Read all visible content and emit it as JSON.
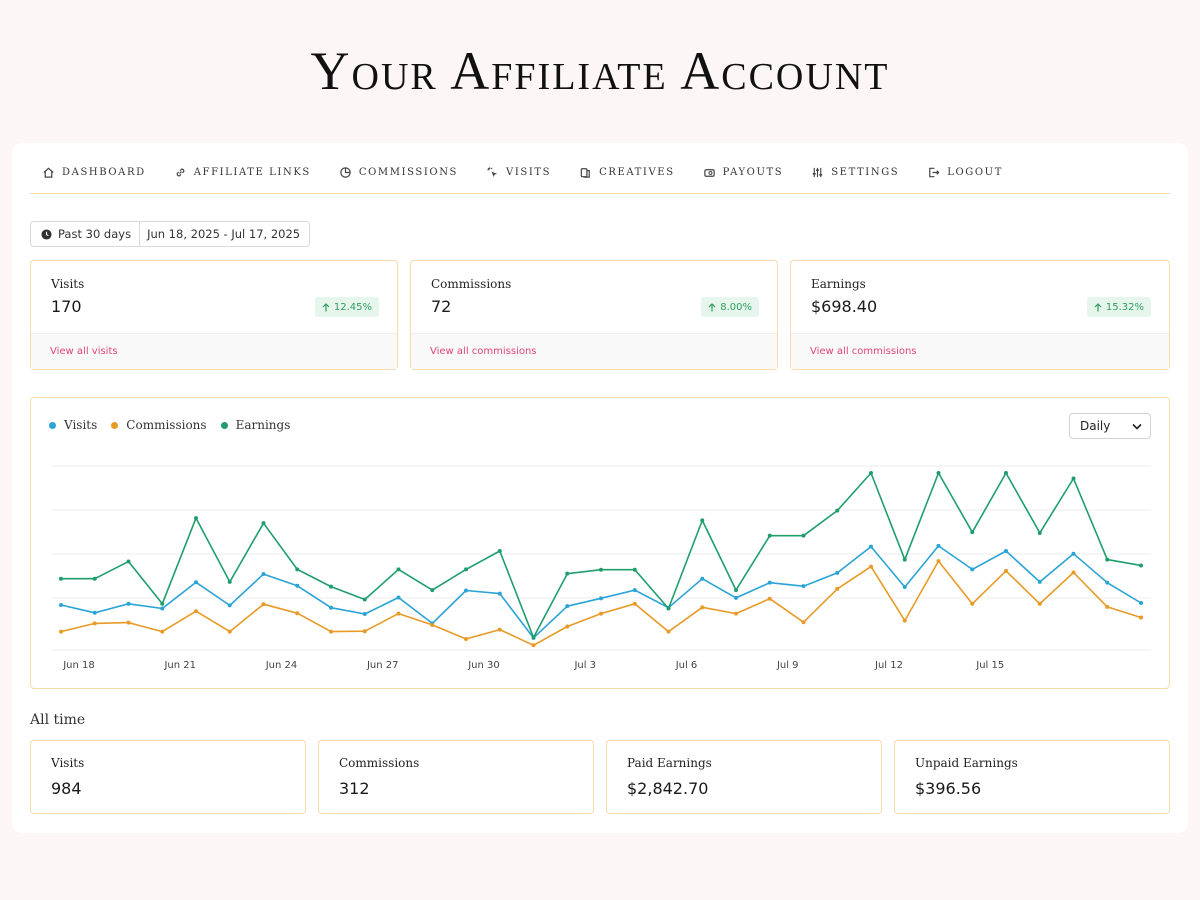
{
  "heading": "Your Affiliate Account",
  "nav": [
    {
      "label": "DASHBOARD",
      "icon": "home-icon"
    },
    {
      "label": "AFFILIATE LINKS",
      "icon": "link-icon"
    },
    {
      "label": "COMMISSIONS",
      "icon": "pie-chart-icon"
    },
    {
      "label": "VISITS",
      "icon": "cursor-click-icon"
    },
    {
      "label": "CREATIVES",
      "icon": "images-icon"
    },
    {
      "label": "PAYOUTS",
      "icon": "wallet-icon"
    },
    {
      "label": "SETTINGS",
      "icon": "sliders-icon"
    },
    {
      "label": "LOGOUT",
      "icon": "logout-icon"
    }
  ],
  "date_range": {
    "preset": "Past 30 days",
    "dates": "Jun 18, 2025 - Jul 17, 2025"
  },
  "cards": [
    {
      "label": "Visits",
      "value": "170",
      "change": "12.45%",
      "link": "View all visits"
    },
    {
      "label": "Commissions",
      "value": "72",
      "change": "8.00%",
      "link": "View all commissions"
    },
    {
      "label": "Earnings",
      "value": "$698.40",
      "change": "15.32%",
      "link": "View all commissions"
    }
  ],
  "chart_controls": {
    "interval": "Daily"
  },
  "chart_data": {
    "type": "line",
    "x_tick_labels": [
      "Jun 18",
      "Jun 21",
      "Jun 24",
      "Jun 27",
      "Jun 30",
      "Jul 3",
      "Jul 6",
      "Jul 9",
      "Jul 12",
      "Jul 15"
    ],
    "grid": true,
    "legend_position": "top-left",
    "series": [
      {
        "name": "Visits",
        "color": "#2aa3d6",
        "values": [
          9.5,
          7.5,
          9.8,
          8.6,
          15.3,
          9.4,
          17.4,
          14.4,
          8.8,
          7.2,
          11.4,
          4.8,
          13.2,
          12.4,
          1.1,
          9.2,
          11.2,
          13.3,
          8.8,
          16.2,
          11.3,
          15.2,
          14.3,
          17.7,
          24.4,
          14.1,
          24.6,
          18.6,
          23.3,
          15.4,
          22.6,
          15.2,
          10.0
        ]
      },
      {
        "name": "Commissions",
        "color": "#e89a26",
        "values": [
          2.7,
          4.8,
          5.0,
          2.7,
          7.9,
          2.7,
          9.7,
          7.4,
          2.7,
          2.8,
          7.3,
          4.4,
          0.8,
          3.2,
          -0.8,
          4.0,
          7.3,
          9.8,
          2.7,
          8.9,
          7.3,
          11.1,
          5.1,
          13.6,
          19.3,
          5.5,
          20.7,
          9.8,
          18.2,
          9.8,
          17.8,
          9.0,
          6.3
        ]
      },
      {
        "name": "Earnings",
        "color": "#1f9e6b",
        "values": [
          16.2,
          16.2,
          20.6,
          9.8,
          31.7,
          15.4,
          30.4,
          18.6,
          14.2,
          10.9,
          18.6,
          13.3,
          18.6,
          23.3,
          1.2,
          17.5,
          18.5,
          18.5,
          8.6,
          31.1,
          13.3,
          27.2,
          27.2,
          33.6,
          43.2,
          21.1,
          43.2,
          28.1,
          43.2,
          27.9,
          41.8,
          21.1,
          19.6
        ]
      }
    ]
  },
  "all_time": {
    "title": "All time",
    "cards": [
      {
        "label": "Visits",
        "value": "984"
      },
      {
        "label": "Commissions",
        "value": "312"
      },
      {
        "label": "Paid Earnings",
        "value": "$2,842.70"
      },
      {
        "label": "Unpaid Earnings",
        "value": "$396.56"
      }
    ]
  }
}
